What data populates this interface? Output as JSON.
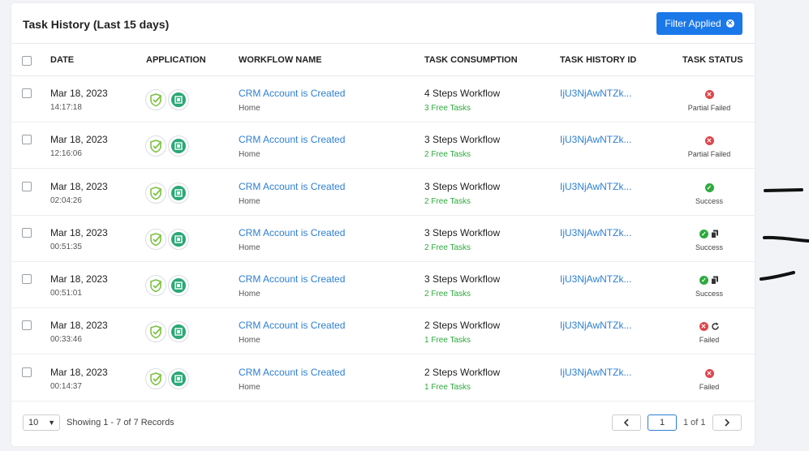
{
  "header": {
    "title": "Task History (Last 15 days)",
    "filter_label": "Filter Applied"
  },
  "columns": {
    "date": "DATE",
    "application": "APPLICATION",
    "workflow_name": "WORKFLOW NAME",
    "task_consumption": "TASK CONSUMPTION",
    "task_history_id": "TASK HISTORY ID",
    "task_status": "TASK STATUS"
  },
  "rows": [
    {
      "date": "Mar 18, 2023",
      "time": "14:17:18",
      "workflow": "CRM Account is Created",
      "folder": "Home",
      "steps": "4 Steps Workflow",
      "free": "3 Free Tasks",
      "id": "IjU3NjAwNTZk...",
      "status": "Partial Failed",
      "status_icons": [
        "error"
      ]
    },
    {
      "date": "Mar 18, 2023",
      "time": "12:16:06",
      "workflow": "CRM Account is Created",
      "folder": "Home",
      "steps": "3 Steps Workflow",
      "free": "2 Free Tasks",
      "id": "IjU3NjAwNTZk...",
      "status": "Partial Failed",
      "status_icons": [
        "error"
      ]
    },
    {
      "date": "Mar 18, 2023",
      "time": "02:04:26",
      "workflow": "CRM Account is Created",
      "folder": "Home",
      "steps": "3 Steps Workflow",
      "free": "2 Free Tasks",
      "id": "IjU3NjAwNTZk...",
      "status": "Success",
      "status_icons": [
        "success"
      ]
    },
    {
      "date": "Mar 18, 2023",
      "time": "00:51:35",
      "workflow": "CRM Account is Created",
      "folder": "Home",
      "steps": "3 Steps Workflow",
      "free": "2 Free Tasks",
      "id": "IjU3NjAwNTZk...",
      "status": "Success",
      "status_icons": [
        "success",
        "copy"
      ]
    },
    {
      "date": "Mar 18, 2023",
      "time": "00:51:01",
      "workflow": "CRM Account is Created",
      "folder": "Home",
      "steps": "3 Steps Workflow",
      "free": "2 Free Tasks",
      "id": "IjU3NjAwNTZk...",
      "status": "Success",
      "status_icons": [
        "success",
        "copy"
      ]
    },
    {
      "date": "Mar 18, 2023",
      "time": "00:33:46",
      "workflow": "CRM Account is Created",
      "folder": "Home",
      "steps": "2 Steps Workflow",
      "free": "1 Free Tasks",
      "id": "IjU3NjAwNTZk...",
      "status": "Failed",
      "status_icons": [
        "error",
        "retry"
      ]
    },
    {
      "date": "Mar 18, 2023",
      "time": "00:14:37",
      "workflow": "CRM Account is Created",
      "folder": "Home",
      "steps": "2 Steps Workflow",
      "free": "1 Free Tasks",
      "id": "IjU3NjAwNTZk...",
      "status": "Failed",
      "status_icons": [
        "error"
      ]
    }
  ],
  "footer": {
    "page_size": "10",
    "showing": "Showing 1 - 7 of 7 Records",
    "prev_icon": "chevron-left-icon",
    "next_icon": "chevron-right-icon",
    "current_page": "1",
    "page_of": "1 of 1"
  },
  "colors": {
    "accent": "#1b78e8",
    "link": "#2d7fd3",
    "success": "#2eaa3d",
    "error": "#e0454b"
  }
}
